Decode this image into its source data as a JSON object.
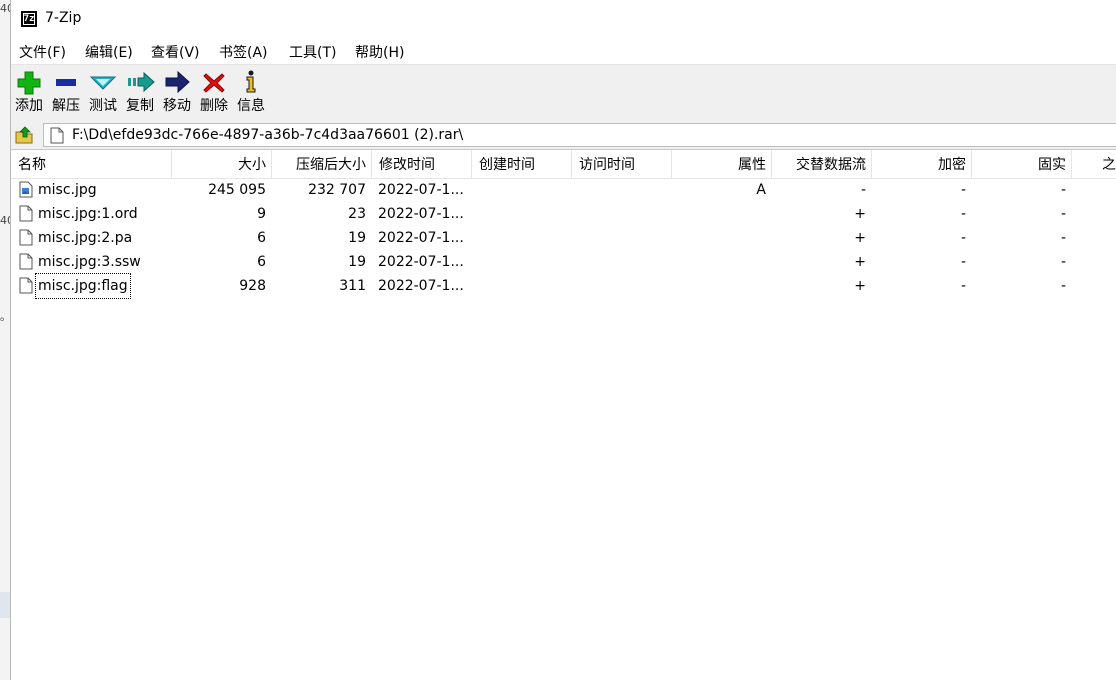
{
  "background": {
    "glyph_top": "40",
    "glyph_mid": "40",
    "glyph_low": "。"
  },
  "window": {
    "title": "7-Zip",
    "app_icon_text": "7z"
  },
  "menu": [
    "文件(F)",
    "编辑(E)",
    "查看(V)",
    "书签(A)",
    "工具(T)",
    "帮助(H)"
  ],
  "toolbar": [
    {
      "label": "添加",
      "icon": "plus-icon",
      "color": "#12b312"
    },
    {
      "label": "解压",
      "icon": "minus-icon",
      "color": "#1b2d9e"
    },
    {
      "label": "测试",
      "icon": "check-chevron-icon",
      "color": "#1fb2c8"
    },
    {
      "label": "复制",
      "icon": "copy-arrow-icon",
      "color": "#169b8f"
    },
    {
      "label": "移动",
      "icon": "move-arrow-icon",
      "color": "#1b2470"
    },
    {
      "label": "删除",
      "icon": "delete-x-icon",
      "color": "#e01010"
    },
    {
      "label": "信息",
      "icon": "info-icon",
      "color": "#d4a80a"
    }
  ],
  "address": {
    "path": "F:\\Dd\\efde93dc-766e-4897-a36b-7c4d3aa76601 (2).rar\\"
  },
  "columns": [
    "名称",
    "大小",
    "压缩后大小",
    "修改时间",
    "创建时间",
    "访问时间",
    "属性",
    "交替数据流",
    "加密",
    "固实",
    "之"
  ],
  "files": [
    {
      "name": "misc.jpg",
      "size": "245 095",
      "packed": "232 707",
      "modified": "2022-07-1...",
      "created": "",
      "accessed": "",
      "attr": "A",
      "alt_streams": "-",
      "encrypted": "-",
      "solid": "-",
      "icon": "image-file-icon"
    },
    {
      "name": "misc.jpg:1.ord",
      "size": "9",
      "packed": "23",
      "modified": "2022-07-1...",
      "created": "",
      "accessed": "",
      "attr": "",
      "alt_streams": "+",
      "encrypted": "-",
      "solid": "-",
      "icon": "file-icon"
    },
    {
      "name": "misc.jpg:2.pa",
      "size": "6",
      "packed": "19",
      "modified": "2022-07-1...",
      "created": "",
      "accessed": "",
      "attr": "",
      "alt_streams": "+",
      "encrypted": "-",
      "solid": "-",
      "icon": "file-icon"
    },
    {
      "name": "misc.jpg:3.ssw",
      "size": "6",
      "packed": "19",
      "modified": "2022-07-1...",
      "created": "",
      "accessed": "",
      "attr": "",
      "alt_streams": "+",
      "encrypted": "-",
      "solid": "-",
      "icon": "file-icon"
    },
    {
      "name": "misc.jpg:flag",
      "size": "928",
      "packed": "311",
      "modified": "2022-07-1...",
      "created": "",
      "accessed": "",
      "attr": "",
      "alt_streams": "+",
      "encrypted": "-",
      "solid": "-",
      "icon": "file-icon",
      "focused": true
    }
  ]
}
